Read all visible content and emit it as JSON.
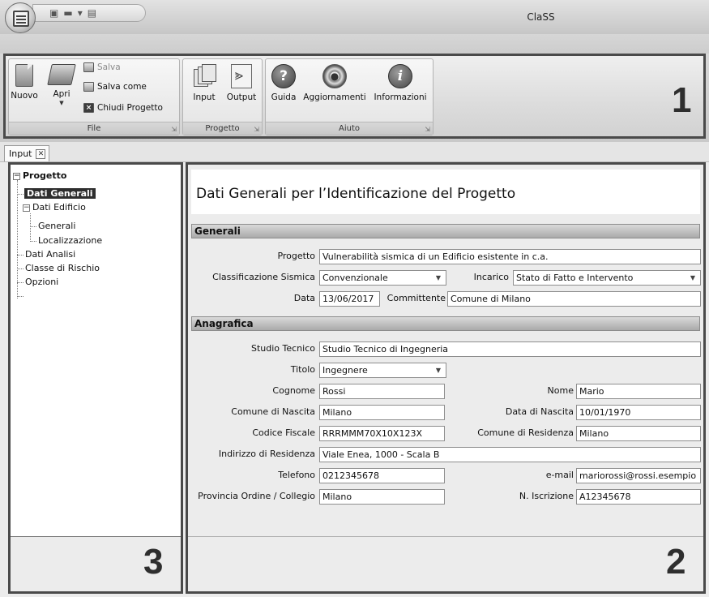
{
  "window": {
    "title": "ClaSS"
  },
  "ribbon": {
    "groups": {
      "file": {
        "label": "File",
        "nuovo": "Nuovo",
        "apri": "Apri",
        "salva": "Salva",
        "salva_come": "Salva come",
        "chiudi": "Chiudi Progetto"
      },
      "progetto": {
        "label": "Progetto",
        "input": "Input",
        "output": "Output"
      },
      "aiuto": {
        "label": "Aiuto",
        "guida": "Guida",
        "aggiornamenti": "Aggiornamenti",
        "informazioni": "Informazioni"
      }
    },
    "marker": "1"
  },
  "doc_tab": {
    "label": "Input"
  },
  "tree": {
    "items": [
      {
        "label": "Progetto"
      },
      {
        "label": "Dati Generali"
      },
      {
        "label": "Dati Edificio"
      },
      {
        "label": "Generali"
      },
      {
        "label": "Localizzazione"
      },
      {
        "label": "Dati Analisi"
      },
      {
        "label": "Classe di Rischio"
      },
      {
        "label": "Opzioni"
      }
    ],
    "marker": "3"
  },
  "main": {
    "title": "Dati Generali per l’Identificazione del Progetto",
    "marker": "2",
    "sections": {
      "generali": "Generali",
      "anagrafica": "Anagrafica"
    },
    "fields": {
      "progetto": {
        "label": "Progetto",
        "value": "Vulnerabilità sismica di un Edificio esistente in c.a."
      },
      "classificazione": {
        "label": "Classificazione Sismica",
        "value": "Convenzionale"
      },
      "incarico": {
        "label": "Incarico",
        "value": "Stato di Fatto e Intervento"
      },
      "data": {
        "label": "Data",
        "value": "13/06/2017"
      },
      "committente": {
        "label": "Committente",
        "value": "Comune di Milano"
      },
      "studio": {
        "label": "Studio Tecnico",
        "value": "Studio Tecnico di Ingegneria"
      },
      "titolo": {
        "label": "Titolo",
        "value": "Ingegnere"
      },
      "cognome": {
        "label": "Cognome",
        "value": "Rossi"
      },
      "nome": {
        "label": "Nome",
        "value": "Mario"
      },
      "comune_nascita": {
        "label": "Comune di Nascita",
        "value": "Milano"
      },
      "data_nascita": {
        "label": "Data di Nascita",
        "value": "10/01/1970"
      },
      "codice_fiscale": {
        "label": "Codice Fiscale",
        "value": "RRRMMM70X10X123X"
      },
      "comune_residenza": {
        "label": "Comune di Residenza",
        "value": "Milano"
      },
      "indirizzo": {
        "label": "Indirizzo di Residenza",
        "value": "Viale Enea, 1000 - Scala B"
      },
      "telefono": {
        "label": "Telefono",
        "value": "0212345678"
      },
      "email": {
        "label": "e-mail",
        "value": "mariorossi@rossi.esempio"
      },
      "provincia": {
        "label": "Provincia Ordine / Collegio",
        "value": "Milano"
      },
      "iscrizione": {
        "label": "N. Iscrizione",
        "value": "A12345678"
      }
    }
  }
}
